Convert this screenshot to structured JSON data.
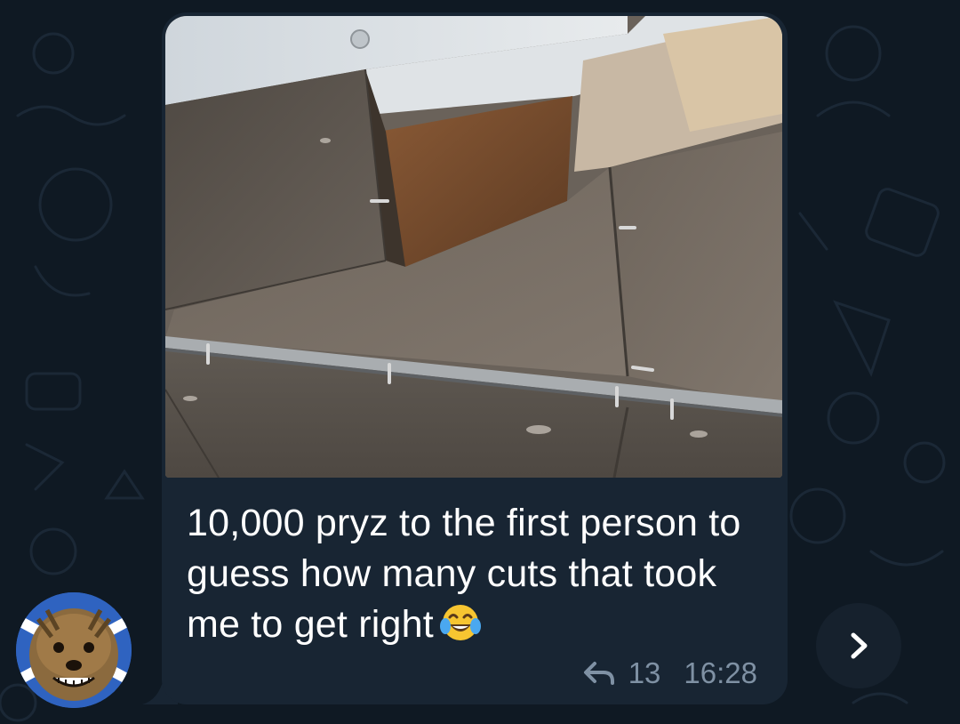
{
  "message": {
    "caption": "10,000 pryz to the first person to guess how many cuts that took me to get right",
    "emoji": "face-with-tears-of-joy",
    "reply_count": "13",
    "time": "16:28"
  },
  "colors": {
    "background": "#0f1923",
    "bubble": "#182533",
    "meta_text": "#7f91a4",
    "caption_text": "#ffffff"
  },
  "icons": {
    "reply": "reply-arrow-icon",
    "forward": "chevron-right-icon"
  }
}
